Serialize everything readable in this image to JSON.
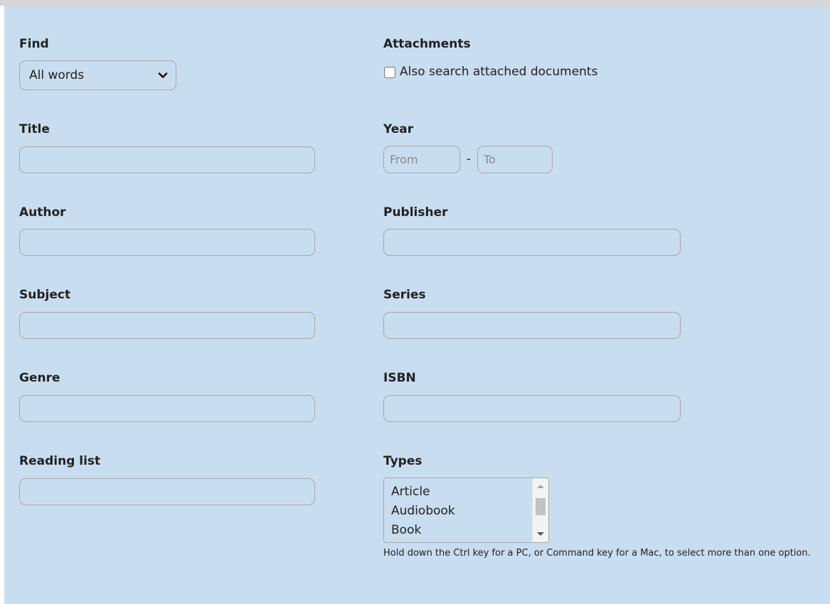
{
  "find": {
    "label": "Find",
    "selected": "All words"
  },
  "attachments": {
    "label": "Attachments",
    "checkbox_label": "Also search attached documents",
    "checked": false
  },
  "title": {
    "label": "Title",
    "value": ""
  },
  "year": {
    "label": "Year",
    "from_placeholder": "From",
    "to_placeholder": "To",
    "separator": "-"
  },
  "author": {
    "label": "Author",
    "value": ""
  },
  "publisher": {
    "label": "Publisher",
    "value": ""
  },
  "subject": {
    "label": "Subject",
    "value": ""
  },
  "series": {
    "label": "Series",
    "value": ""
  },
  "genre": {
    "label": "Genre",
    "value": ""
  },
  "isbn": {
    "label": "ISBN",
    "value": ""
  },
  "reading_list": {
    "label": "Reading list",
    "value": ""
  },
  "types": {
    "label": "Types",
    "options": [
      "Article",
      "Audiobook",
      "Book"
    ],
    "hint": "Hold down the Ctrl key for a PC, or Command key for a Mac, to select more than one option."
  },
  "colors": {
    "panel_bg": "#c8ddef",
    "border": "#a9a9a9"
  },
  "icons": {
    "select_arrow": "chevron-down-icon"
  }
}
